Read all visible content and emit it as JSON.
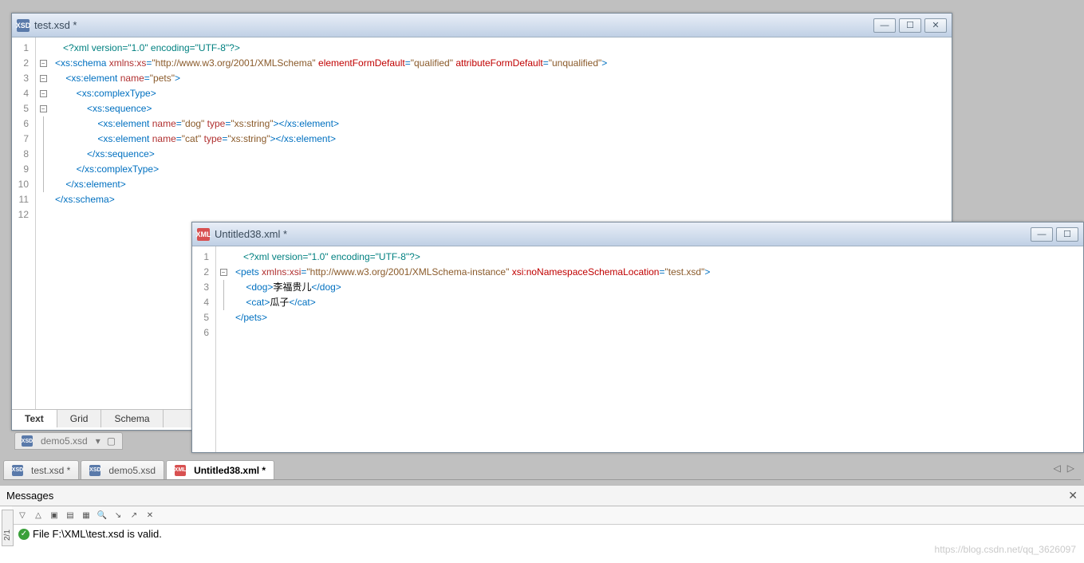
{
  "window1": {
    "title": "test.xsd *",
    "lines": [
      1,
      2,
      3,
      4,
      5,
      6,
      7,
      8,
      9,
      10,
      11,
      12
    ],
    "code": {
      "l1": {
        "pi": "<?xml version=\"1.0\" encoding=\"UTF-8\"?>"
      },
      "l2": {
        "open": "<",
        "tag": "xs:schema ",
        "a1": "xmlns:xs",
        "eq1": "=",
        "v1": "\"http://www.w3.org/2001/XMLSchema\" ",
        "a2": "elementFormDefault",
        "eq2": "=",
        "v2": "\"qualified\" ",
        "a3": "attributeFormDefault",
        "eq3": "=",
        "v3": "\"unqualified\"",
        "close": ">"
      },
      "l3": {
        "open": "<",
        "tag": "xs:element ",
        "a1": "name",
        "eq1": "=",
        "v1": "\"pets\"",
        "close": ">"
      },
      "l4": {
        "open": "<",
        "tag": "xs:complexType",
        "close": ">"
      },
      "l5": {
        "open": "<",
        "tag": "xs:sequence",
        "close": ">"
      },
      "l6": {
        "open": "<",
        "tag": "xs:element ",
        "a1": "name",
        "eq1": "=",
        "v1": "\"dog\" ",
        "a2": "type",
        "eq2": "=",
        "v2": "\"xs:string\"",
        "mid": "></",
        "tag2": "xs:element",
        "close": ">"
      },
      "l7": {
        "open": "<",
        "tag": "xs:element ",
        "a1": "name",
        "eq1": "=",
        "v1": "\"cat\" ",
        "a2": "type",
        "eq2": "=",
        "v2": "\"xs:string\"",
        "mid": "></",
        "tag2": "xs:element",
        "close": ">"
      },
      "l8": {
        "open": "</",
        "tag": "xs:sequence",
        "close": ">"
      },
      "l9": {
        "open": "</",
        "tag": "xs:complexType",
        "close": ">"
      },
      "l10": {
        "open": "</",
        "tag": "xs:element",
        "close": ">"
      },
      "l11": {
        "open": "</",
        "tag": "xs:schema",
        "close": ">"
      }
    },
    "viewTabs": {
      "text": "Text",
      "grid": "Grid",
      "schema": "Schema"
    }
  },
  "window2": {
    "title": "Untitled38.xml *",
    "lines": [
      1,
      2,
      3,
      4,
      5,
      6
    ],
    "code": {
      "l1": {
        "pi": "<?xml version=\"1.0\" encoding=\"UTF-8\"?>"
      },
      "l2": {
        "open": "<",
        "tag": "pets ",
        "a1": "xmlns:xsi",
        "eq1": "=",
        "v1": "\"http://www.w3.org/2001/XMLSchema-instance\" ",
        "a2": "xsi:noNamespaceSchemaLocation",
        "eq2": "=",
        "v2": "\"test.xsd\"",
        "close": ">"
      },
      "l3": {
        "open": "<",
        "tag": "dog",
        "mid": ">",
        "text": "李福贵儿",
        "close1": "</",
        "tag2": "dog",
        "close2": ">"
      },
      "l4": {
        "open": "<",
        "tag": "cat",
        "mid": ">",
        "text": "瓜子",
        "close1": "</",
        "tag2": "cat",
        "close2": ">"
      },
      "l5": {
        "open": "</",
        "tag": "pets",
        "close": ">"
      }
    }
  },
  "hiddenTab": "demo5.xsd",
  "fileTabs": [
    {
      "label": "test.xsd *",
      "icon": "xsd",
      "active": false
    },
    {
      "label": "demo5.xsd",
      "icon": "xsd",
      "active": false
    },
    {
      "label": "Untitled38.xml *",
      "icon": "xml",
      "active": true
    }
  ],
  "messages": {
    "title": "Messages",
    "status": "File F:\\XML\\test.xsd is valid.",
    "sideLabel": "2/1"
  },
  "watermark": "https://blog.csdn.net/qq_3626097"
}
